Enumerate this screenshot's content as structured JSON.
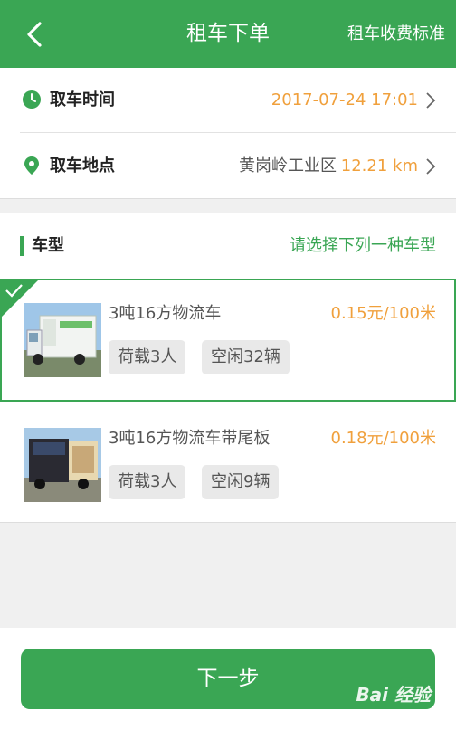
{
  "header": {
    "title": "租车下单",
    "fee_link": "租车收费标准"
  },
  "pickup": {
    "time_label": "取车时间",
    "time_value": "2017-07-24 17:01",
    "location_label": "取车地点",
    "location_name": "黄岗岭工业区",
    "location_distance": "12.21 km"
  },
  "vehicle_section": {
    "title": "车型",
    "hint": "请选择下列一种车型",
    "vehicles": [
      {
        "name": "3吨16方物流车",
        "price": "0.15元/100米",
        "capacity": "荷载3人",
        "available": "空闲32辆",
        "selected": true
      },
      {
        "name": "3吨16方物流车带尾板",
        "price": "0.18元/100米",
        "capacity": "荷载3人",
        "available": "空闲9辆",
        "selected": false
      }
    ]
  },
  "footer": {
    "next_label": "下一步",
    "watermark": "Bai 经验"
  },
  "colors": {
    "accent": "#3aa654",
    "price": "#f0a03c"
  }
}
